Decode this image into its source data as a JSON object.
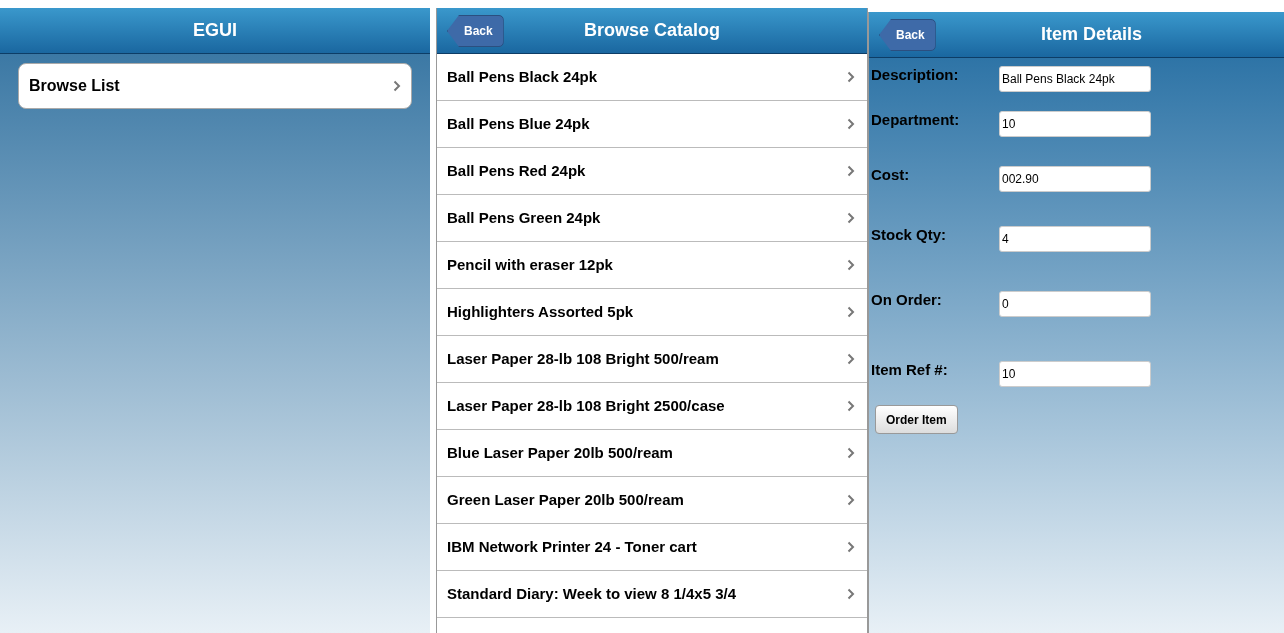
{
  "left_panel": {
    "title": "EGUI",
    "items": [
      {
        "label": "Browse List"
      }
    ]
  },
  "middle_panel": {
    "back": "Back",
    "title": "Browse Catalog",
    "items": [
      {
        "label": "Ball Pens Black 24pk"
      },
      {
        "label": "Ball Pens Blue 24pk"
      },
      {
        "label": "Ball Pens Red 24pk"
      },
      {
        "label": "Ball Pens Green 24pk"
      },
      {
        "label": "Pencil with eraser 12pk"
      },
      {
        "label": "Highlighters Assorted 5pk"
      },
      {
        "label": "Laser Paper 28-lb 108 Bright 500/ream"
      },
      {
        "label": "Laser Paper 28-lb 108 Bright 2500/case"
      },
      {
        "label": "Blue Laser Paper 20lb 500/ream"
      },
      {
        "label": "Green Laser Paper 20lb 500/ream"
      },
      {
        "label": "IBM Network Printer 24 - Toner cart"
      },
      {
        "label": "Standard Diary: Week to view 8 1/4x5 3/4"
      }
    ]
  },
  "right_panel": {
    "back": "Back",
    "title": "Item Details",
    "fields": [
      {
        "label": "Description:",
        "value": "Ball Pens Black 24pk"
      },
      {
        "label": "Department:",
        "value": "10"
      },
      {
        "label": "Cost:",
        "value": "002.90"
      },
      {
        "label": "Stock Qty:",
        "value": "4"
      },
      {
        "label": "On Order:",
        "value": "0"
      },
      {
        "label": "Item Ref #:",
        "value": "10"
      }
    ],
    "button": "Order Item"
  }
}
